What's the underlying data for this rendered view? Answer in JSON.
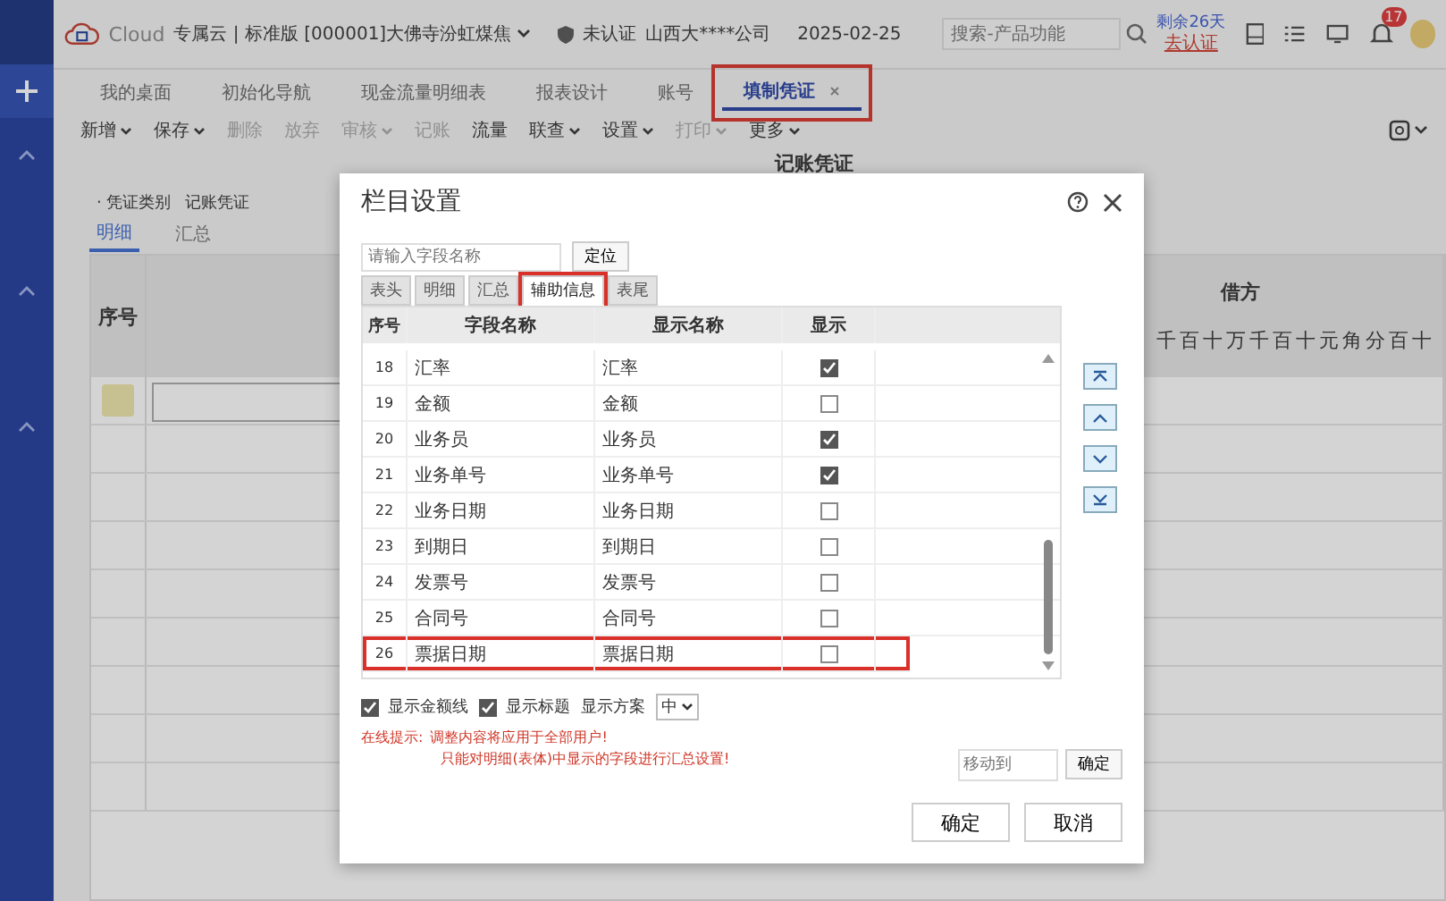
{
  "header": {
    "brand": "Cloud",
    "account": "专属云 | 标准版 [000001]大佛寺汾虹煤焦",
    "cert_status": "未认证",
    "company": "山西大****公司",
    "date": "2025-02-25",
    "search": {
      "placeholder": "搜索-产品功能"
    },
    "trial": "剩余26天",
    "certify_link": "去认证",
    "notifications": "17"
  },
  "tabs": [
    {
      "label": "我的桌面",
      "selected": false,
      "closable": false,
      "highlighted": false
    },
    {
      "label": "初始化导航",
      "selected": false,
      "closable": false,
      "highlighted": false
    },
    {
      "label": "现金流量明细表",
      "selected": false,
      "closable": false,
      "highlighted": false
    },
    {
      "label": "报表设计",
      "selected": false,
      "closable": false,
      "highlighted": false
    },
    {
      "label": "账号",
      "selected": false,
      "closable": false,
      "highlighted": false
    },
    {
      "label": "填制凭证",
      "selected": true,
      "closable": true,
      "highlighted": true
    }
  ],
  "toolbar": [
    {
      "label": "新增",
      "dropdown": true,
      "disabled": false
    },
    {
      "label": "保存",
      "dropdown": true,
      "disabled": false
    },
    {
      "label": "删除",
      "dropdown": false,
      "disabled": true
    },
    {
      "label": "放弃",
      "dropdown": false,
      "disabled": true
    },
    {
      "label": "审核",
      "dropdown": true,
      "disabled": true
    },
    {
      "label": "记账",
      "dropdown": false,
      "disabled": true
    },
    {
      "label": "流量",
      "dropdown": false,
      "disabled": false
    },
    {
      "label": "联查",
      "dropdown": true,
      "disabled": false
    },
    {
      "label": "设置",
      "dropdown": true,
      "disabled": false
    },
    {
      "label": "打印",
      "dropdown": true,
      "disabled": true
    },
    {
      "label": "更多",
      "dropdown": true,
      "disabled": false
    }
  ],
  "voucher": {
    "title": "记账凭证",
    "type_label": "· 凭证类别",
    "type_value": "记账凭证",
    "subtabs": [
      {
        "label": "明细",
        "selected": true
      },
      {
        "label": "汇总",
        "selected": false
      }
    ],
    "columns": [
      "序号",
      "借方"
    ],
    "debit_digits": "千百十万千百十元角分百十"
  },
  "dialog": {
    "title": "栏目设置",
    "search": {
      "placeholder": "请输入字段名称"
    },
    "locate_button": "定位",
    "tabs": [
      {
        "label": "表头",
        "selected": false,
        "highlighted": false
      },
      {
        "label": "明细",
        "selected": false,
        "highlighted": false
      },
      {
        "label": "汇总",
        "selected": false,
        "highlighted": false
      },
      {
        "label": "辅助信息",
        "selected": true,
        "highlighted": true
      },
      {
        "label": "表尾",
        "selected": false,
        "highlighted": false
      }
    ],
    "columns": [
      "序号",
      "字段名称",
      "显示名称",
      "显示"
    ],
    "rows": [
      {
        "no": "18",
        "field": "汇率",
        "display": "汇率",
        "show": true,
        "highlighted": false
      },
      {
        "no": "19",
        "field": "金额",
        "display": "金额",
        "show": false,
        "highlighted": false
      },
      {
        "no": "20",
        "field": "业务员",
        "display": "业务员",
        "show": true,
        "highlighted": false
      },
      {
        "no": "21",
        "field": "业务单号",
        "display": "业务单号",
        "show": true,
        "highlighted": false
      },
      {
        "no": "22",
        "field": "业务日期",
        "display": "业务日期",
        "show": false,
        "highlighted": false
      },
      {
        "no": "23",
        "field": "到期日",
        "display": "到期日",
        "show": false,
        "highlighted": false
      },
      {
        "no": "24",
        "field": "发票号",
        "display": "发票号",
        "show": false,
        "highlighted": false
      },
      {
        "no": "25",
        "field": "合同号",
        "display": "合同号",
        "show": false,
        "highlighted": false
      },
      {
        "no": "26",
        "field": "票据日期",
        "display": "票据日期",
        "show": false,
        "highlighted": true
      }
    ],
    "options": [
      {
        "label": "显示金额线",
        "checked": true
      },
      {
        "label": "显示标题",
        "checked": true
      }
    ],
    "scheme_label": "显示方案",
    "scheme_value": "中",
    "hint_label": "在线提示:",
    "hints": [
      "调整内容将应用于全部用户!",
      "只能对明细(表体)中显示的字段进行汇总设置!"
    ],
    "move_to": {
      "placeholder": "移动到"
    },
    "move_button": "确定",
    "buttons": [
      "确定",
      "取消"
    ]
  }
}
